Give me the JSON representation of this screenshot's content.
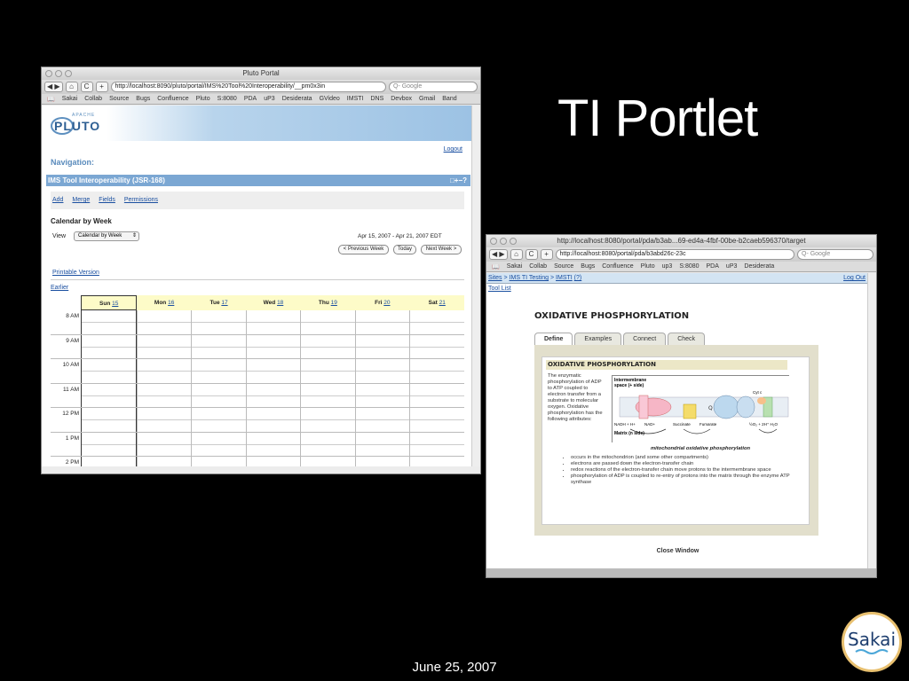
{
  "slide": {
    "title": "TI Portlet",
    "footer": "June 25, 2007",
    "logo_text": "Sakai"
  },
  "window1": {
    "title": "Pluto Portal",
    "url": "http://localhost:8090/pluto/portal/IMS%20Tool%20Interoperability/__pm0x3in",
    "search_placeholder": "Q- Google",
    "bookmarks": [
      "Sakai",
      "Collab",
      "Source",
      "Bugs",
      "Confluence",
      "Pluto",
      "S:8080",
      "PDA",
      "uP3",
      "Desiderata",
      "GVideo",
      "IMSTI",
      "DNS",
      "Devbox",
      "Gmail",
      "Band"
    ],
    "logo_apache": "APACHE",
    "logo_pluto": "PLUTO",
    "logout": "Logout",
    "navigation_label": "Navigation:",
    "portlet_title": "IMS Tool Interoperability (JSR-168)",
    "portlet_controls": "□+−?",
    "links": [
      "Add",
      "Merge",
      "Fields",
      "Permissions"
    ],
    "calendar_title": "Calendar by Week",
    "view_label": "View",
    "view_value": "Calendar by Week",
    "date_range": "Apr 15, 2007 - Apr 21, 2007 EDT",
    "prev_week": "< Previous Week",
    "today": "Today",
    "next_week": "Next Week >",
    "printable_version": "Printable Version",
    "earlier": "Earlier",
    "days": [
      {
        "name": "Sun",
        "num": "15"
      },
      {
        "name": "Mon",
        "num": "16"
      },
      {
        "name": "Tue",
        "num": "17"
      },
      {
        "name": "Wed",
        "num": "18"
      },
      {
        "name": "Thu",
        "num": "19"
      },
      {
        "name": "Fri",
        "num": "20"
      },
      {
        "name": "Sat",
        "num": "21"
      }
    ],
    "hours": [
      "8 AM",
      "9 AM",
      "10 AM",
      "11 AM",
      "12 PM",
      "1 PM",
      "2 PM"
    ]
  },
  "window2": {
    "url": "http://localhost:8080/portal/pda/b3abd26c-23c",
    "title": "http://localhost:8080/portal/pda/b3ab...69-ed4a-4fbf-00be-b2caeb596370/target",
    "search_placeholder": "Q- Google",
    "bookmarks": [
      "Sakai",
      "Collab",
      "Source",
      "Bugs",
      "Confluence",
      "Pluto",
      "up3",
      "S:8080",
      "PDA",
      "uP3",
      "Desiderata"
    ],
    "breadcrumb_sites": "Sites",
    "breadcrumb_sep": ">",
    "breadcrumb_testing": "IMS TI Testing",
    "breadcrumb_imsti": "IMSTI",
    "breadcrumb_help": "(?)",
    "logout": "Log Out",
    "tool_list": "Tool List",
    "heading": "OXIDATIVE PHOSPHORYLATION",
    "tabs": [
      "Define",
      "Examples",
      "Connect",
      "Check"
    ],
    "inner_title": "OXIDATIVE PHOSPHORYLATION",
    "description": "The enzymatic phosphorylation of ADP to ATP coupled to electron transfer from a substrate to molecular oxygen. Oxidative phosphorylation has the following attributes:",
    "diagram_labels": {
      "intermembrane": "Intermembrane space (+ side)",
      "matrix": "Matrix (n side)",
      "nadh": "NADH + H+",
      "nad": "NAD+",
      "succinate": "Succinate",
      "fumarate": "Fumarate",
      "cyt": "Cyt c",
      "water": "½O₂ + 2H⁺   H₂O"
    },
    "caption": "mitochondrial oxidative phosphorylation",
    "bullets": [
      "occurs in the mitochondrion (and some other compartments)",
      "electrons are passed down the electron-transfer chain",
      "redox reactions of the electron-transfer chain move protons to the intermembrane space",
      "phosphorylation of ADP is coupled to re-entry of protons into the matrix through the enzyme ATP synthase"
    ],
    "close_window": "Close Window"
  }
}
